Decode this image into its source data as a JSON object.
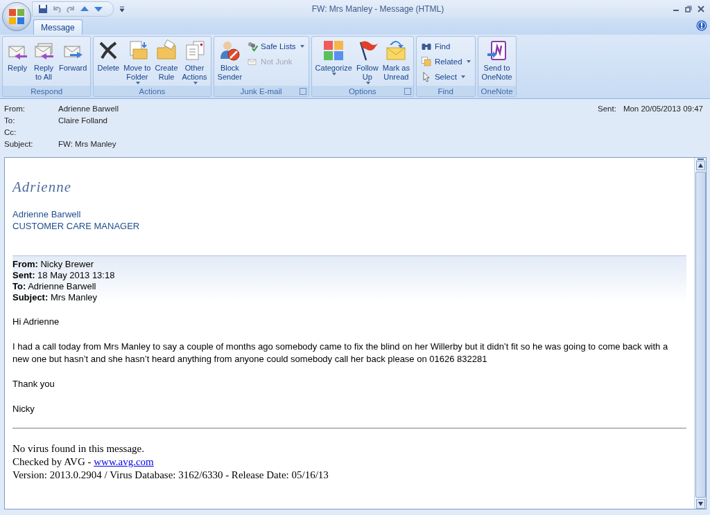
{
  "window": {
    "title": "FW: Mrs Manley - Message (HTML)"
  },
  "tabs": [
    {
      "label": "Message",
      "selected": true
    }
  ],
  "ribbon": {
    "groups": [
      {
        "label": "Respond",
        "launcher": false,
        "buttons": [
          {
            "kind": "large",
            "label": "Reply",
            "dropdown": false,
            "disabled": false
          },
          {
            "kind": "large",
            "label": "Reply\nto All",
            "dropdown": false,
            "disabled": false
          },
          {
            "kind": "large",
            "label": "Forward",
            "dropdown": false,
            "disabled": false
          }
        ]
      },
      {
        "label": "Actions",
        "launcher": false,
        "buttons": [
          {
            "kind": "large",
            "label": "Delete",
            "dropdown": false,
            "disabled": false
          },
          {
            "kind": "large",
            "label": "Move to\nFolder",
            "dropdown": true,
            "disabled": false
          },
          {
            "kind": "large",
            "label": "Create\nRule",
            "dropdown": false,
            "disabled": false
          },
          {
            "kind": "large",
            "label": "Other\nActions",
            "dropdown": true,
            "disabled": false
          }
        ]
      },
      {
        "label": "Junk E-mail",
        "launcher": true,
        "buttons": [
          {
            "kind": "large",
            "label": "Block\nSender",
            "dropdown": false,
            "disabled": false
          },
          {
            "kind": "small",
            "label": "Safe Lists",
            "dropdown": true,
            "disabled": false
          },
          {
            "kind": "small",
            "label": "Not Junk",
            "dropdown": false,
            "disabled": true
          }
        ]
      },
      {
        "label": "Options",
        "launcher": true,
        "buttons": [
          {
            "kind": "large",
            "label": "Categorize",
            "dropdown": true,
            "disabled": false
          },
          {
            "kind": "large",
            "label": "Follow\nUp",
            "dropdown": true,
            "disabled": false
          },
          {
            "kind": "large",
            "label": "Mark as\nUnread",
            "dropdown": false,
            "disabled": false
          }
        ]
      },
      {
        "label": "Find",
        "launcher": false,
        "buttons": [
          {
            "kind": "small",
            "label": "Find",
            "dropdown": false,
            "disabled": false
          },
          {
            "kind": "small",
            "label": "Related",
            "dropdown": true,
            "disabled": false
          },
          {
            "kind": "small",
            "label": "Select",
            "dropdown": true,
            "disabled": false
          }
        ]
      },
      {
        "label": "OneNote",
        "launcher": false,
        "buttons": [
          {
            "kind": "large",
            "label": "Send to\nOneNote",
            "dropdown": false,
            "disabled": false
          }
        ]
      }
    ]
  },
  "header": {
    "fields": [
      {
        "label": "From:",
        "value": "Adrienne Barwell"
      },
      {
        "label": "To:",
        "value": "Claire Folland"
      },
      {
        "label": "Cc:"
      },
      {
        "label": "Subject:",
        "value": "FW: Mrs Manley"
      }
    ],
    "sent": {
      "label": "Sent:",
      "value": "Mon 20/05/2013 09:47"
    }
  },
  "body": {
    "signature": {
      "script": "Adrienne",
      "name": "Adrienne Barwell",
      "title": "CUSTOMER CARE MANAGER"
    },
    "forwarded": [
      "**From:** Nicky Brewer",
      "**Sent:** 18 May 2013 13:18",
      "**To:** Adrienne Barwell",
      "**Subject:** Mrs Manley"
    ],
    "paragraphs": [
      "Hi Adrienne",
      "I had a call today from Mrs Manley to say a couple of months ago somebody came to fix the blind on her Willerby but it didn’t fit so he was going to come back with a new one but hasn’t and she hasn’t heard anything from anyone could somebody call her back please on 01626 832281",
      "Thank you",
      "Nicky"
    ],
    "footer": {
      "line1": "No virus found in this message.",
      "line2": "Checked by AVG - ",
      "link": "www.avg.com",
      "line3": "Version: 2013.0.2904 / Virus Database: 3162/6330 - Release Date: 05/16/13"
    }
  }
}
